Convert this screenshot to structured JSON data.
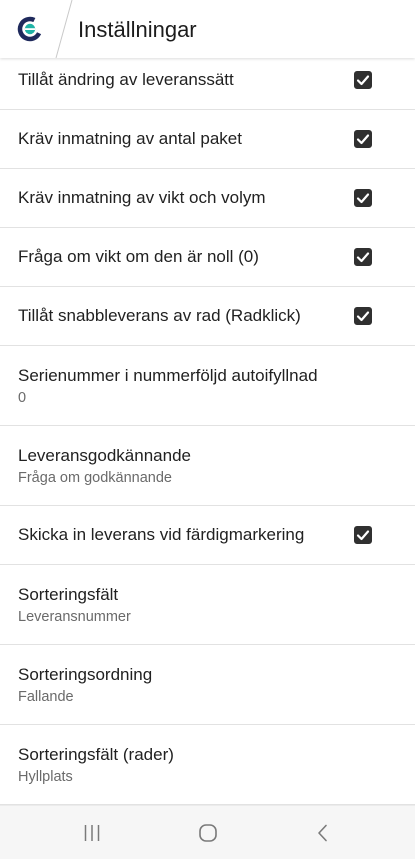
{
  "header": {
    "title": "Inställningar",
    "logo_icon": "app-logo-icon"
  },
  "settings": [
    {
      "title": "Tillåt ändring av leveranssätt",
      "checked": true
    },
    {
      "title": "Kräv inmatning av antal paket",
      "checked": true
    },
    {
      "title": "Kräv inmatning av vikt och volym",
      "checked": true
    },
    {
      "title": "Fråga om vikt om den är noll (0)",
      "checked": true
    },
    {
      "title": "Tillåt snabbleverans av rad (Radklick)",
      "checked": true
    },
    {
      "title": "Serienummer i nummerföljd autoifyllnad",
      "subtitle": "0"
    },
    {
      "title": "Leveransgodkännande",
      "subtitle": "Fråga om godkännande"
    },
    {
      "title": "Skicka in leverans vid färdigmarkering",
      "checked": true
    },
    {
      "title": "Sorteringsfält",
      "subtitle": "Leveransnummer"
    },
    {
      "title": "Sorteringsordning",
      "subtitle": "Fallande"
    },
    {
      "title": "Sorteringsfält (rader)",
      "subtitle": "Hyllplats"
    }
  ],
  "nav": {
    "recents_icon": "recents-icon",
    "home_icon": "home-icon",
    "back_icon": "back-icon"
  },
  "colors": {
    "checkbox": "#303030",
    "title_text": "#212121",
    "subtitle_text": "#6a6a6a",
    "divider": "#e2e2e2",
    "nav_background": "#f6f6f6",
    "logo_navy": "#1f2a5c",
    "logo_teal": "#20b3a6"
  }
}
